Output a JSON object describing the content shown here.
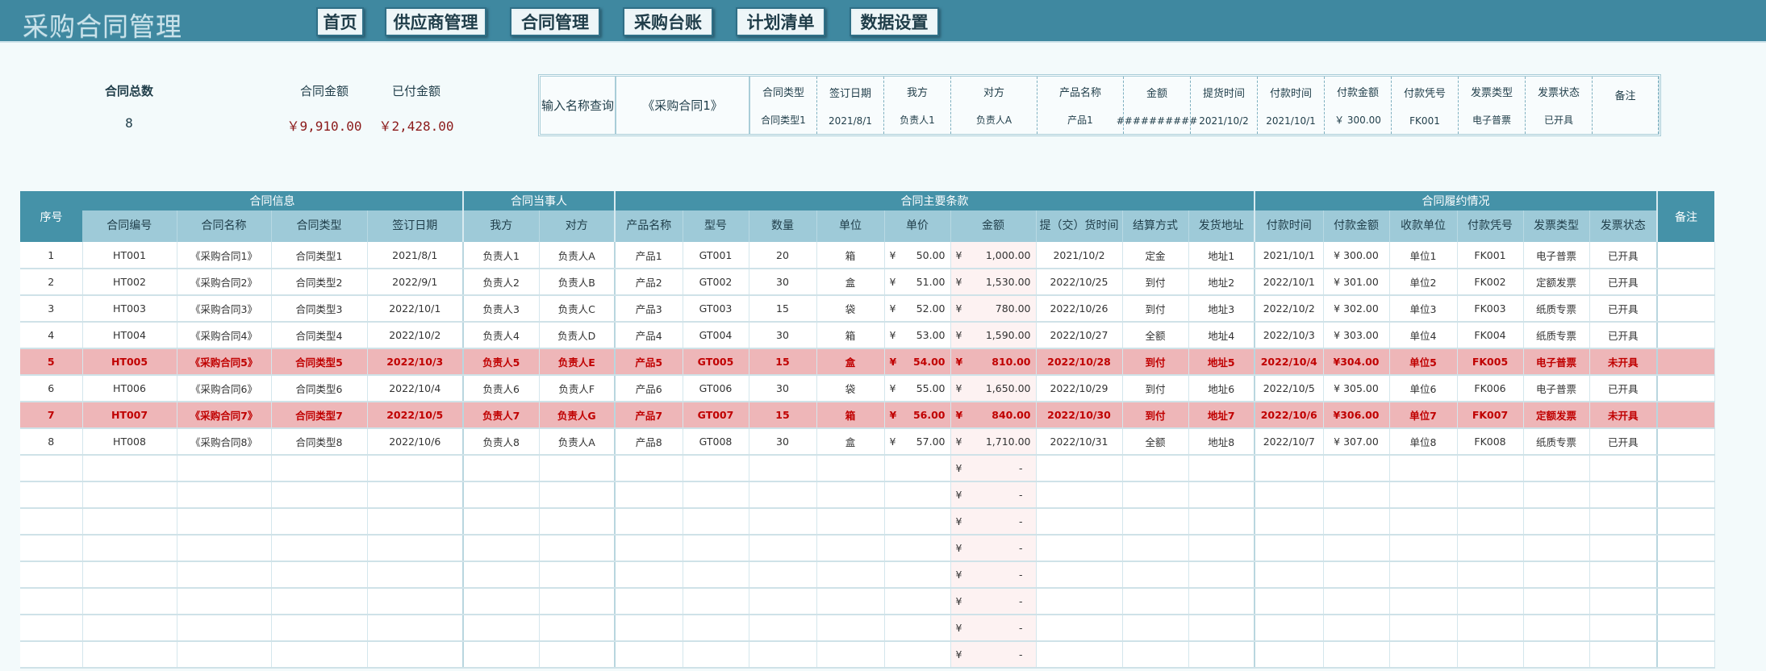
{
  "app_title": "采购合同管理",
  "nav": [
    "首页",
    "供应商管理",
    "合同管理",
    "采购台账",
    "计划清单",
    "数据设置"
  ],
  "summary": {
    "total_label": "合同总数",
    "total_value": "8",
    "amount_label": "合同金额",
    "amount_value": "￥9,910.00",
    "paid_label": "已付金额",
    "paid_value": "￥2,428.00"
  },
  "search": {
    "label": "输入名称查询",
    "input_value": "《采购合同1》",
    "fields": [
      {
        "h": "合同类型",
        "v": "合同类型1"
      },
      {
        "h": "签订日期",
        "v": "2021/8/1"
      },
      {
        "h": "我方",
        "v": "负责人1"
      },
      {
        "h": "对方",
        "v": "负责人A"
      },
      {
        "h": "产品名称",
        "v": "产品1"
      },
      {
        "h": "金额",
        "v": "##########"
      },
      {
        "h": "提货时间",
        "v": "2021/10/2"
      },
      {
        "h": "付款时间",
        "v": "2021/10/1"
      },
      {
        "h": "付款金额",
        "v": "￥ 300.00"
      },
      {
        "h": "付款凭号",
        "v": "FK001"
      },
      {
        "h": "发票类型",
        "v": "电子普票"
      },
      {
        "h": "发票状态",
        "v": "已开具"
      },
      {
        "h": "备注",
        "v": ""
      }
    ]
  },
  "table": {
    "index_header": "序号",
    "remark_header": "备注",
    "groups": [
      {
        "label": "合同信息",
        "span": 4
      },
      {
        "label": "合同当事人",
        "span": 2
      },
      {
        "label": "合同主要条款",
        "span": 9
      },
      {
        "label": "合同履约情况",
        "span": 6
      }
    ],
    "columns": [
      "合同编号",
      "合同名称",
      "合同类型",
      "签订日期",
      "我方",
      "对方",
      "产品名称",
      "型号",
      "数量",
      "单位",
      "单价",
      "金额",
      "提（交）货时间",
      "结算方式",
      "发货地址",
      "付款时间",
      "付款金额",
      "收款单位",
      "付款凭号",
      "发票类型",
      "发票状态"
    ],
    "currency": "¥",
    "empty_amount": "-",
    "rows": [
      {
        "hl": false,
        "c": [
          "1",
          "HT001",
          "《采购合同1》",
          "合同类型1",
          "2021/8/1",
          "负责人1",
          "负责人A",
          "产品1",
          "GT001",
          "20",
          "箱",
          "50.00",
          "1,000.00",
          "2021/10/2",
          "定金",
          "地址1",
          "2021/10/1",
          "¥ 300.00",
          "单位1",
          "FK001",
          "电子普票",
          "已开具",
          ""
        ]
      },
      {
        "hl": false,
        "c": [
          "2",
          "HT002",
          "《采购合同2》",
          "合同类型2",
          "2022/9/1",
          "负责人2",
          "负责人B",
          "产品2",
          "GT002",
          "30",
          "盒",
          "51.00",
          "1,530.00",
          "2022/10/25",
          "到付",
          "地址2",
          "2022/10/1",
          "¥ 301.00",
          "单位2",
          "FK002",
          "定额发票",
          "已开具",
          ""
        ]
      },
      {
        "hl": false,
        "c": [
          "3",
          "HT003",
          "《采购合同3》",
          "合同类型3",
          "2022/10/1",
          "负责人3",
          "负责人C",
          "产品3",
          "GT003",
          "15",
          "袋",
          "52.00",
          "780.00",
          "2022/10/26",
          "到付",
          "地址3",
          "2022/10/2",
          "¥ 302.00",
          "单位3",
          "FK003",
          "纸质专票",
          "已开具",
          ""
        ]
      },
      {
        "hl": false,
        "c": [
          "4",
          "HT004",
          "《采购合同4》",
          "合同类型4",
          "2022/10/2",
          "负责人4",
          "负责人D",
          "产品4",
          "GT004",
          "30",
          "箱",
          "53.00",
          "1,590.00",
          "2022/10/27",
          "全额",
          "地址4",
          "2022/10/3",
          "¥ 303.00",
          "单位4",
          "FK004",
          "纸质专票",
          "已开具",
          ""
        ]
      },
      {
        "hl": true,
        "c": [
          "5",
          "HT005",
          "《采购合同5》",
          "合同类型5",
          "2022/10/3",
          "负责人5",
          "负责人E",
          "产品5",
          "GT005",
          "15",
          "盒",
          "54.00",
          "810.00",
          "2022/10/28",
          "到付",
          "地址5",
          "2022/10/4",
          "¥304.00",
          "单位5",
          "FK005",
          "电子普票",
          "未开具",
          ""
        ]
      },
      {
        "hl": false,
        "c": [
          "6",
          "HT006",
          "《采购合同6》",
          "合同类型6",
          "2022/10/4",
          "负责人6",
          "负责人F",
          "产品6",
          "GT006",
          "30",
          "袋",
          "55.00",
          "1,650.00",
          "2022/10/29",
          "到付",
          "地址6",
          "2022/10/5",
          "¥ 305.00",
          "单位6",
          "FK006",
          "电子普票",
          "已开具",
          ""
        ]
      },
      {
        "hl": true,
        "c": [
          "7",
          "HT007",
          "《采购合同7》",
          "合同类型7",
          "2022/10/5",
          "负责人7",
          "负责人G",
          "产品7",
          "GT007",
          "15",
          "箱",
          "56.00",
          "840.00",
          "2022/10/30",
          "到付",
          "地址7",
          "2022/10/6",
          "¥306.00",
          "单位7",
          "FK007",
          "定额发票",
          "未开具",
          ""
        ]
      },
      {
        "hl": false,
        "c": [
          "8",
          "HT008",
          "《采购合同8》",
          "合同类型8",
          "2022/10/6",
          "负责人8",
          "负责人A",
          "产品8",
          "GT008",
          "30",
          "盒",
          "57.00",
          "1,710.00",
          "2022/10/31",
          "全额",
          "地址8",
          "2022/10/7",
          "¥ 307.00",
          "单位8",
          "FK008",
          "纸质专票",
          "已开具",
          ""
        ]
      }
    ],
    "empty_rows": 8
  }
}
